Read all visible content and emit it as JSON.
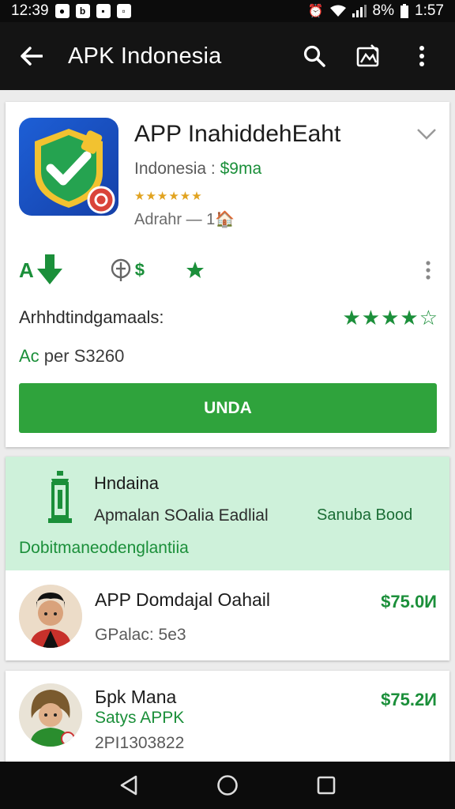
{
  "status_bar": {
    "time_left": "12:39",
    "battery": "8%",
    "time_right": "1:57"
  },
  "app_bar": {
    "title": "APK Indonesia",
    "icons": [
      "back-arrow-icon",
      "search-icon",
      "gallery-icon",
      "more-vert-icon"
    ]
  },
  "app_card": {
    "name": "APP InahiddehEaht",
    "subtitle_prefix": "Indonesia : ",
    "subtitle_price": "$9ma",
    "meta": "Adrahr — 1🏠",
    "actions": {
      "download_label": "A",
      "referral_label": "$"
    },
    "rating_label": "Arhhdtindgamaals:",
    "rating_value_stars": 4.5,
    "price_line_prefix": "Ac",
    "price_line_rest": " per S3260",
    "install_label": "UNDA"
  },
  "promo": {
    "title": "Hndaina",
    "line": "Apmalan SOalia Eadlial",
    "right_text": "Sanuba Bood",
    "link": "Dobitmaneodenglantiia"
  },
  "list": [
    {
      "name": "APP Domdajal Oahail",
      "sub": "GPalac: 5e3",
      "price": "$75.0И"
    },
    {
      "name": "Бpk Mana",
      "sub_green": "Satys APPK",
      "sub": "2PI1303822",
      "price": "$75.2И"
    }
  ],
  "colors": {
    "accent_green": "#2fa33c",
    "dark_green": "#1b8f3a",
    "promo_bg": "#cef1da",
    "app_bar": "#141414"
  }
}
